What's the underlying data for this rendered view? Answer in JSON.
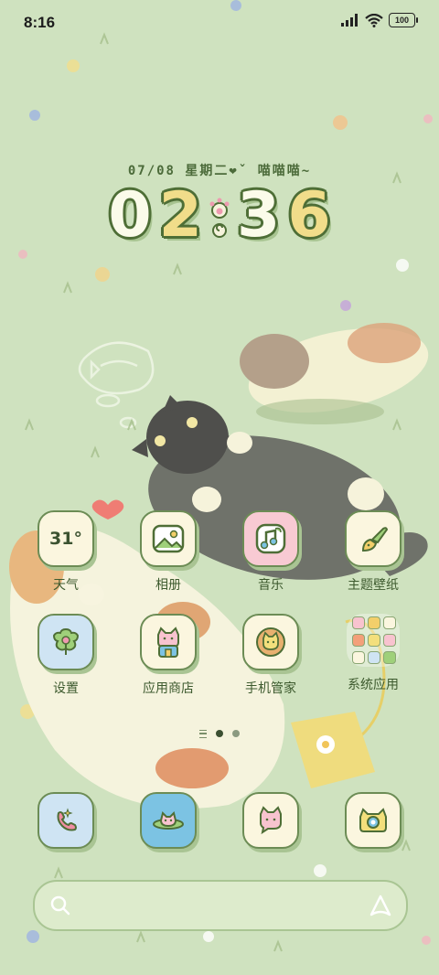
{
  "status": {
    "time": "8:16",
    "battery": "100"
  },
  "widget": {
    "date_line": "07/08 星期二❤ˇ  喵喵喵~",
    "h1": "0",
    "h2": "2",
    "m1": "3",
    "m2": "6"
  },
  "apps": {
    "weather": {
      "label": "天气",
      "temp": "31°"
    },
    "gallery": {
      "label": "相册"
    },
    "music": {
      "label": "音乐"
    },
    "themes": {
      "label": "主题壁纸"
    },
    "settings": {
      "label": "设置"
    },
    "store": {
      "label": "应用商店"
    },
    "security": {
      "label": "手机管家"
    },
    "system": {
      "label": "系统应用"
    }
  },
  "dock": [
    "phone-icon",
    "browser-icon",
    "messages-icon",
    "camera-icon"
  ],
  "search": {
    "placeholder": ""
  },
  "colors": {
    "wallpaper": "#cfe2bf",
    "outline": "#4e6e36",
    "tile": "#fbf6df"
  }
}
